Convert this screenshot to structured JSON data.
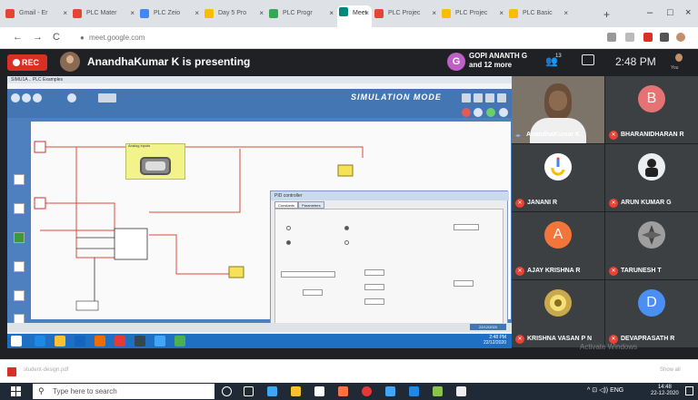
{
  "browser": {
    "tabs": [
      {
        "label": "Gmail - Er",
        "color": "#ea4335"
      },
      {
        "label": "PLC Mater",
        "color": "#ea4335"
      },
      {
        "label": "PLC Zeio",
        "color": "#4285f4"
      },
      {
        "label": "Day 5 Pro",
        "color": "#fbbc04"
      },
      {
        "label": "PLC Progr",
        "color": "#34a853"
      },
      {
        "label": "Meet",
        "color": "#00897b"
      },
      {
        "label": "PLC Projec",
        "color": "#ea4335"
      },
      {
        "label": "PLC Projec",
        "color": "#fbbc04"
      },
      {
        "label": "PLC Basic",
        "color": "#fbbc04"
      }
    ],
    "close_glyph": "×",
    "new_tab_glyph": "+",
    "url": "meet.google.com",
    "window_controls": {
      "minimize": "–",
      "maximize": "□",
      "close": "×"
    }
  },
  "meet": {
    "rec_label": "REC",
    "presenting_text": "AnandhaKumar K is presenting",
    "top_user": {
      "initial": "G",
      "name": "GOPI ANANTH G",
      "extra": "and 12 more",
      "color": "#c05fc6"
    },
    "people_count": "13",
    "clock": "2:48 PM",
    "self_label": "You",
    "watermark": "Activate Windows",
    "participants": [
      {
        "name": "AnandhaKumar K",
        "type": "video"
      },
      {
        "name": "BHARANIDHARAN R",
        "initial": "B",
        "color": "#e57373"
      },
      {
        "name": "JANANI R",
        "type": "google"
      },
      {
        "name": "ARUN KUMAR G",
        "type": "photo-dark"
      },
      {
        "name": "AJAY KRISHNA R",
        "initial": "A",
        "color": "#f4753a"
      },
      {
        "name": "TARUNESH T",
        "type": "photo-grey"
      },
      {
        "name": "KRISHNA VASAN P N",
        "type": "photo-gold"
      },
      {
        "name": "DEVAPRASATH R",
        "initial": "D",
        "color": "#4b8ff5"
      }
    ]
  },
  "shared": {
    "app_title": "SIMU1A .. PLC Examples",
    "sim_title": "SIMULATION MODE",
    "analog_title": "Analog inputs",
    "pid_title": "PID controller",
    "pid_tabs": [
      "Constants",
      "Parameters"
    ],
    "inner_time": "2:48 PM",
    "inner_date": "22/12/2020"
  },
  "download": {
    "filename": "student-design.pdf",
    "show_all": "Show all"
  },
  "taskbar": {
    "search_placeholder": "Type here to search",
    "tray_lang": "ENG",
    "time": "14:48",
    "date": "22-12-2020"
  }
}
